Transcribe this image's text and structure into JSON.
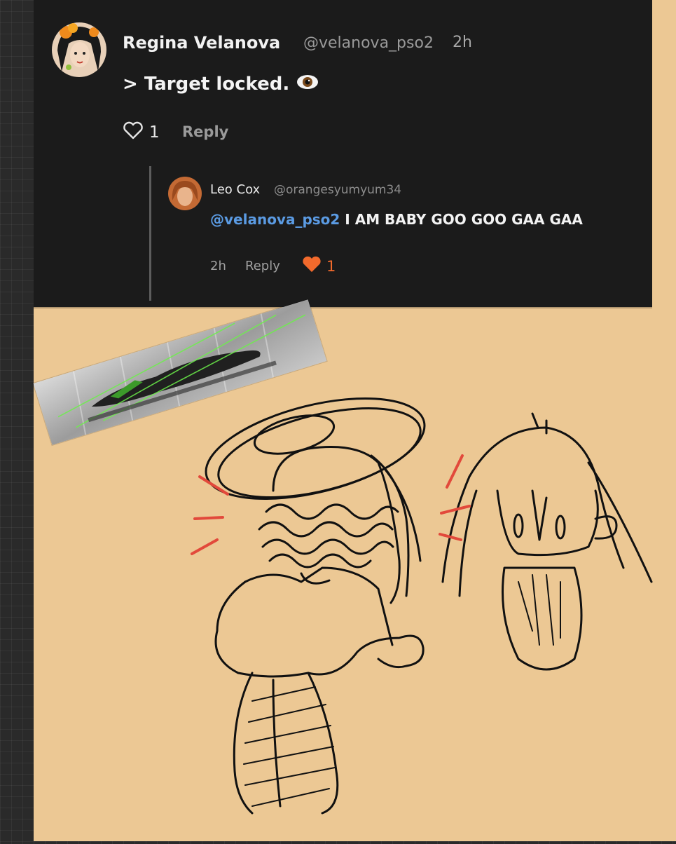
{
  "comment": {
    "author_name": "Regina Velanova",
    "author_handle": "@velanova_pso2",
    "timestamp": "2h",
    "text": "> Target locked.",
    "emoji": "eye-emoji",
    "like_count": "1",
    "reply_label": "Reply"
  },
  "reply": {
    "author_name": "Leo Cox",
    "author_handle": "@orangesyumyum34",
    "mention": "@velanova_pso2",
    "text": " I AM BABY GOO GOO GAA GAA",
    "timestamp": "2h",
    "reply_label": "Reply",
    "like_count": "1"
  },
  "colors": {
    "panel": "#1b1b1b",
    "canvas": "#ecc894",
    "mention": "#5b9be3",
    "liked_heart": "#f26a2c",
    "scribble_red": "#e2493b"
  },
  "icons": [
    "heart-outline-icon",
    "heart-filled-icon",
    "eye-emoji"
  ]
}
